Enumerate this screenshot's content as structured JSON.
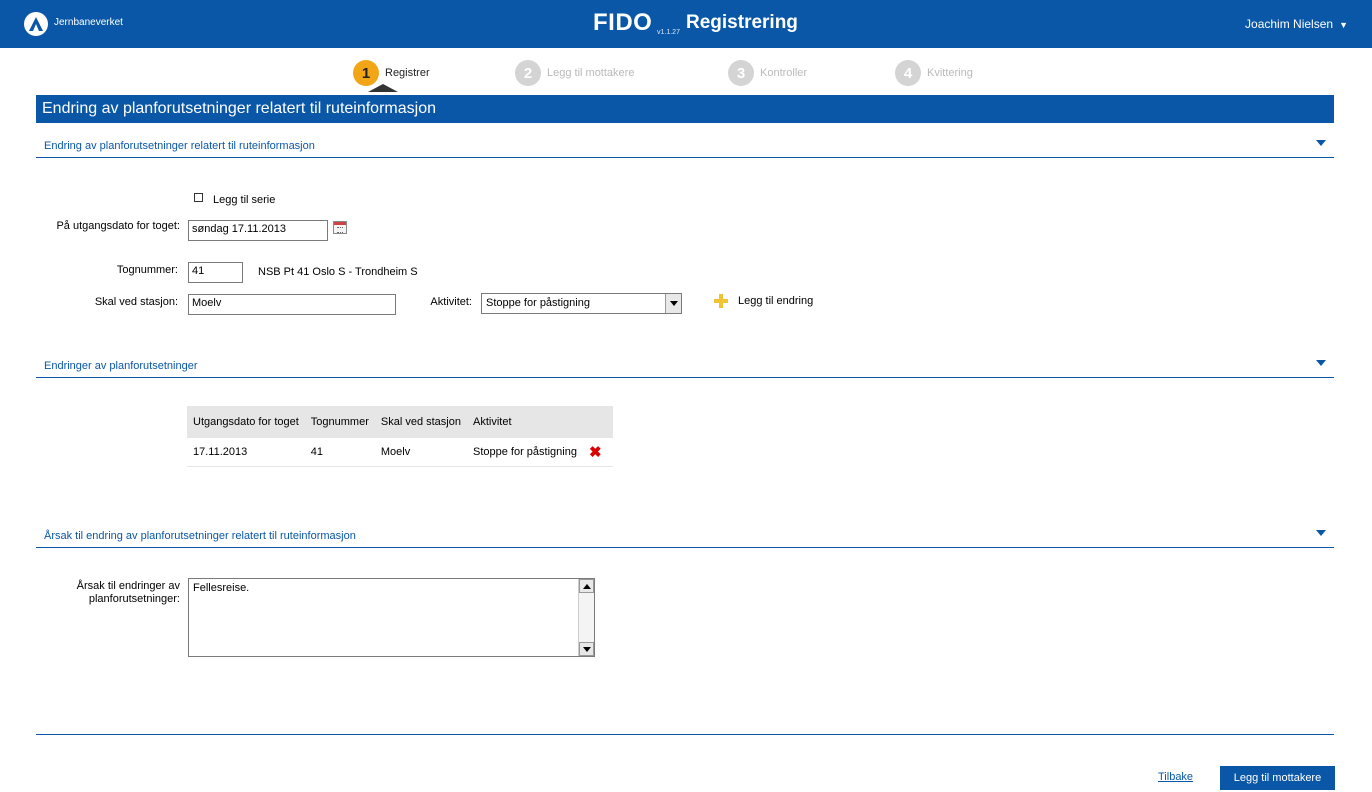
{
  "header": {
    "brand": "Jernbaneverket",
    "app_name": "FIDO",
    "version": "v1.1.27",
    "page_title": "Registrering",
    "user_name": "Joachim Nielsen"
  },
  "steps": [
    {
      "num": "1",
      "label": "Registrer",
      "state": "active"
    },
    {
      "num": "2",
      "label": "Legg til mottakere",
      "state": "inactive"
    },
    {
      "num": "3",
      "label": "Kontroller",
      "state": "inactive"
    },
    {
      "num": "4",
      "label": "Kvittering",
      "state": "inactive"
    }
  ],
  "main_title": "Endring av planforutsetninger relatert til ruteinformasjon",
  "section1": {
    "title": "Endring av planforutsetninger relatert til ruteinformasjon",
    "series_checkbox_label": "Legg til serie",
    "series_checked": false,
    "date_label": "På utgangsdato for toget:",
    "date_value": "søndag 17.11.2013",
    "train_label": "Tognummer:",
    "train_value": "41",
    "train_desc": "NSB Pt 41 Oslo S - Trondheim S",
    "station_label": "Skal ved stasjon:",
    "station_value": "Moelv",
    "activity_label": "Aktivitet:",
    "activity_value": "Stoppe for påstigning",
    "add_change_label": "Legg til endring"
  },
  "section2": {
    "title": "Endringer av planforutsetninger",
    "columns": [
      "Utgangsdato for toget",
      "Tognummer",
      "Skal ved stasjon",
      "Aktivitet"
    ],
    "rows": [
      [
        "17.11.2013",
        "41",
        "Moelv",
        "Stoppe for påstigning"
      ]
    ]
  },
  "section3": {
    "title": "Årsak til endring av planforutsetninger relatert til ruteinformasjon",
    "reason_label": "Årsak til endringer av planforutsetninger:",
    "reason_value": "Fellesreise."
  },
  "footer": {
    "back_label": "Tilbake",
    "next_label": "Legg til mottakere"
  },
  "colors": {
    "primary": "#0a57a8",
    "step_active": "#f2a516",
    "step_inactive": "#d4d4d4",
    "delete": "#dd0000"
  }
}
